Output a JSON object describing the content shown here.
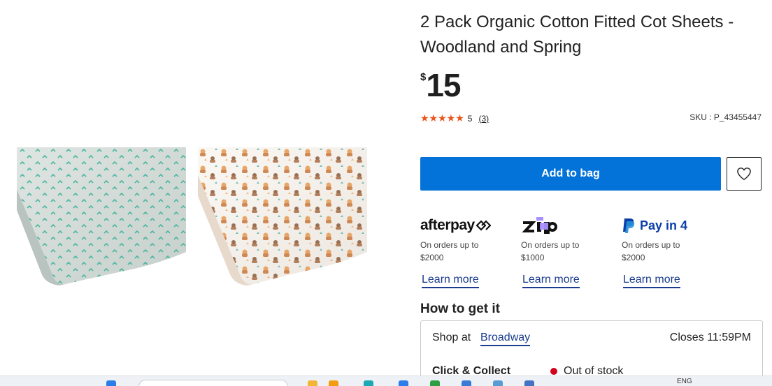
{
  "product": {
    "title": "2 Pack Organic Cotton Fitted Cot Sheets - Woodland and Spring",
    "currency": "$",
    "price": "15",
    "rating_stars": "★★★★★",
    "rating_value": "5",
    "rating_count": "(3)",
    "sku": "SKU : P_43455447"
  },
  "actions": {
    "add_to_bag": "Add to bag",
    "wishlist_icon": "heart-icon"
  },
  "payments": [
    {
      "name": "afterpay",
      "desc_line1": "On orders up to",
      "desc_line2": "$2000",
      "learn": "Learn more"
    },
    {
      "name": "zip",
      "desc_line1": "On orders up to",
      "desc_line2": "$1000",
      "learn": "Learn more"
    },
    {
      "name": "Pay in 4",
      "desc_line1": "On orders up to",
      "desc_line2": "$2000",
      "learn": "Learn more"
    }
  ],
  "fulfilment": {
    "heading": "How to get it",
    "shop_at": "Shop at",
    "store": "Broadway",
    "closes": "Closes 11:59PM",
    "click_collect": "Click & Collect",
    "stock_status": "Out of stock"
  },
  "taskbar": {
    "lang": "ENG"
  },
  "colors": {
    "primary": "#0473d9",
    "star": "#e8551c",
    "link": "#1a3b8e",
    "out_of_stock": "#d0021b"
  }
}
